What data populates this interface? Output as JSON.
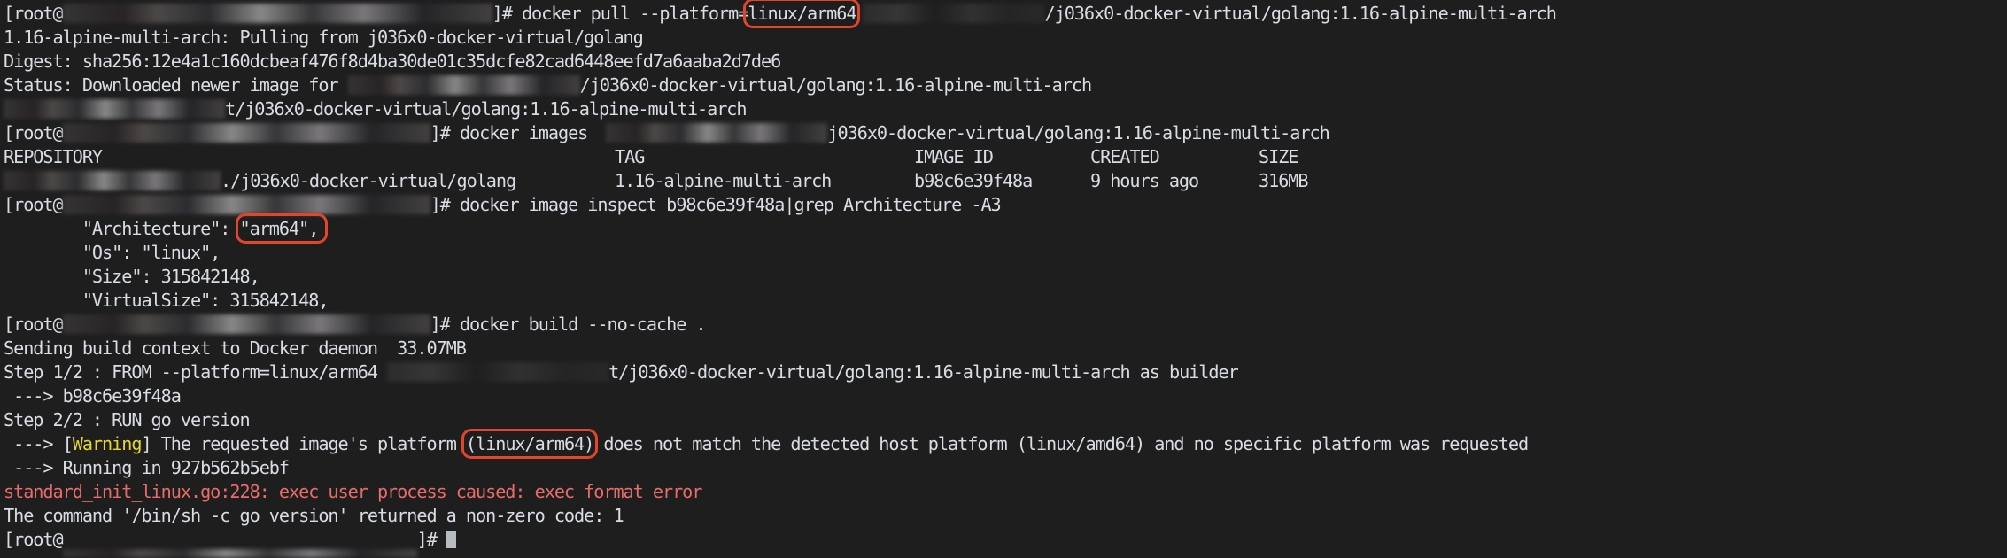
{
  "terminal": {
    "prompt_prefix": "[root@",
    "prompt_suffix": "]# ",
    "commands": {
      "pull": "docker pull --platform=",
      "pull_platform": "linux/arm64",
      "pull_image_tail": "/j036x0-docker-virtual/golang:1.16-alpine-multi-arch",
      "images": "docker images ",
      "images_tail": "j036x0-docker-virtual/golang:1.16-alpine-multi-arch",
      "inspect": "docker image inspect b98c6e39f48a|grep Architecture -A3",
      "build": "docker build --no-cache ."
    },
    "pull_output": {
      "pulling": "1.16-alpine-multi-arch: Pulling from j036x0-docker-virtual/golang",
      "digest": "Digest: sha256:12e4a1c160dcbeaf476f8d4ba30de01c35dcfe82cad6448eefd7a6aaba2d7de6",
      "status_prefix": "Status: Downloaded newer image for ",
      "status_tail": "/j036x0-docker-virtual/golang:1.16-alpine-multi-arch",
      "image_ref_tail": "t/j036x0-docker-virtual/golang:1.16-alpine-multi-arch"
    },
    "images_table": {
      "headers": [
        "REPOSITORY",
        "TAG",
        "IMAGE ID",
        "CREATED",
        "SIZE"
      ],
      "rows": [
        {
          "repository_tail": "./j036x0-docker-virtual/golang",
          "tag": "1.16-alpine-multi-arch",
          "image_id": "b98c6e39f48a",
          "created": "9 hours ago",
          "size": "316MB"
        }
      ]
    },
    "inspect_output": {
      "arch_key": "        \"Architecture\": ",
      "arch_value": "\"arm64\",",
      "os": "        \"Os\": \"linux\",",
      "size": "        \"Size\": 315842148,",
      "virtual_size": "        \"VirtualSize\": 315842148,"
    },
    "build_output": {
      "context": "Sending build context to Docker daemon  33.07MB",
      "step1_prefix": "Step 1/2 : FROM --platform=linux/arm64 ",
      "step1_tail": "t/j036x0-docker-virtual/golang:1.16-alpine-multi-arch as builder",
      "step1_result": " ---> b98c6e39f48a",
      "step2": "Step 2/2 : RUN go version",
      "warning_arrow": " ---> [",
      "warning_label": "Warning",
      "warning_mid": "] The requested image's platform ",
      "warning_platform": "(linux/arm64)",
      "warning_tail": " does not match the detected host platform (linux/amd64) and no specific platform was requested",
      "running": " ---> Running in 927b562b5ebf",
      "error": "standard_init_linux.go:228: exec user process caused: exec format error",
      "command_failed": "The command '/bin/sh -c go version' returned a non-zero code: 1"
    },
    "colors": {
      "background": "#1e1e1e",
      "text": "#d8dde3",
      "warning": "#e4d52f",
      "error": "#e86c6c",
      "highlight_box": "#e2452c"
    }
  }
}
